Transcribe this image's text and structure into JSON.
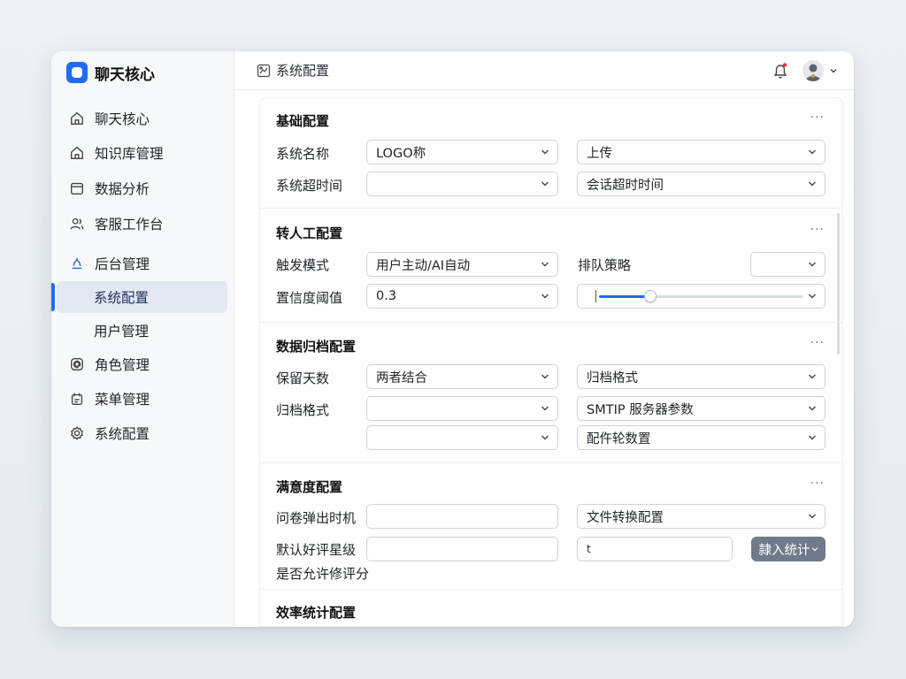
{
  "app": {
    "title": "聊天核心"
  },
  "sidebar": {
    "items": [
      {
        "label": "聊天核心",
        "icon": "home-icon"
      },
      {
        "label": "知识库管理",
        "icon": "home-icon"
      },
      {
        "label": "数据分析",
        "icon": "calendar-icon"
      },
      {
        "label": "客服工作台",
        "icon": "users-icon"
      },
      {
        "label": "后台管理",
        "icon": "admin-icon"
      },
      {
        "label": "系统配置",
        "active": true
      },
      {
        "label": "用户管理"
      },
      {
        "label": "角色管理",
        "icon": "at-icon"
      },
      {
        "label": "菜单管理",
        "icon": "menu-icon"
      },
      {
        "label": "系统配置",
        "icon": "gear-icon"
      }
    ]
  },
  "header": {
    "breadcrumb": "系统配置",
    "accent": "#1f6bf3",
    "notification_dot": "#e53935"
  },
  "sections": {
    "basic": {
      "title": "基础配置",
      "more": "···",
      "name_label": "系统名称",
      "name_value": "LOGO称",
      "upload_value": "上传",
      "timeout_label": "系统超时间",
      "timeout_value": "",
      "session_value": "会话超时时间"
    },
    "handoff": {
      "title": "转人工配置",
      "more": "···",
      "trigger_label": "触发模式",
      "trigger_value": "用户主动/AI自动",
      "queue_label": "排队策略",
      "queue_value": "",
      "confidence_label": "置信度阈值",
      "confidence_value": "0.3",
      "slider_level": 0.25
    },
    "archive": {
      "title": "数据归档配置",
      "more": "···",
      "retention_label": "保留天数",
      "retention_value": "两者结合",
      "format_value_right": "归档格式",
      "format_label": "归档格式",
      "format_value": "",
      "smtp_value": "SMTIP 服务器参数",
      "extra_value": "",
      "poll_value": "配仵轮数置"
    },
    "satisfaction": {
      "title": "满意度配置",
      "more": "···",
      "popup_label": "问卷弹出时机",
      "popup_value": "",
      "convert_value": "文件转换配置",
      "rating_label": "默认好评星级",
      "rating_value": "",
      "rating_right_value": "t",
      "allow_edit_label": "是否允许修评分",
      "stat_button": "隷入统计"
    },
    "efficiency": {
      "title": "效率统计配置"
    }
  }
}
